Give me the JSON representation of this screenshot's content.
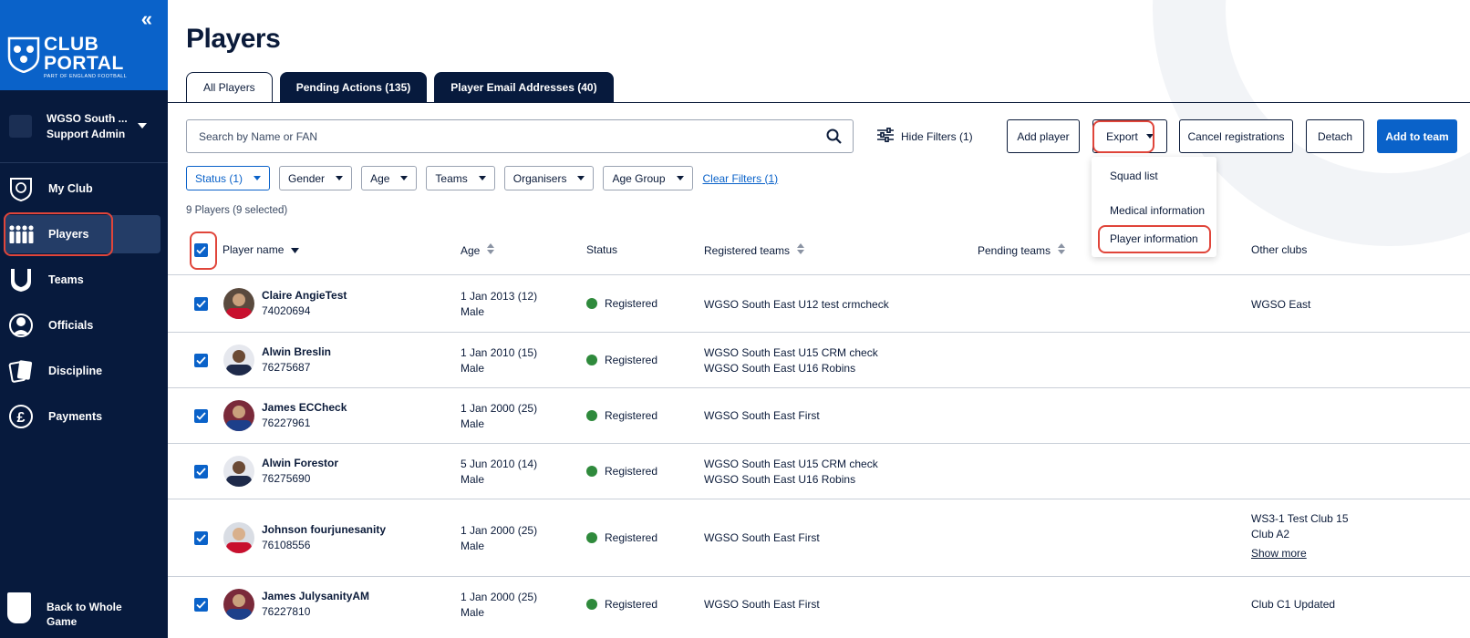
{
  "sidebar": {
    "logo": {
      "line1": "CLUB",
      "line2": "PORTAL",
      "line3": "PART OF ENGLAND FOOTBALL"
    },
    "account": {
      "name": "WGSO South ...",
      "role": "Support Admin"
    },
    "nav": [
      {
        "label": "My Club",
        "icon": "shield-icon"
      },
      {
        "label": "Players",
        "icon": "players-icon"
      },
      {
        "label": "Teams",
        "icon": "kit-icon"
      },
      {
        "label": "Officials",
        "icon": "whistle-icon"
      },
      {
        "label": "Discipline",
        "icon": "cards-icon"
      },
      {
        "label": "Payments",
        "icon": "pound-icon"
      }
    ],
    "back": "Back to Whole Game"
  },
  "page": {
    "title": "Players"
  },
  "tabs": [
    {
      "label": "All Players",
      "active": true
    },
    {
      "label": "Pending Actions (135)",
      "active": false
    },
    {
      "label": "Player Email Addresses (40)",
      "active": false
    }
  ],
  "search": {
    "placeholder": "Search by Name or FAN"
  },
  "toolbar": {
    "hide_filters": "Hide Filters (1)",
    "add_player": "Add player",
    "export": "Export",
    "cancel_registrations": "Cancel registrations",
    "detach": "Detach",
    "add_to_team": "Add to team"
  },
  "export_menu": [
    "Squad list",
    "Medical information",
    "Player information"
  ],
  "filters": {
    "chips": [
      "Status (1)",
      "Gender",
      "Age",
      "Teams",
      "Organisers",
      "Age Group"
    ],
    "clear": "Clear Filters (1)"
  },
  "summary": "9 Players (9 selected)",
  "columns": {
    "name": "Player name",
    "age": "Age",
    "status": "Status",
    "registered": "Registered teams",
    "pending": "Pending teams",
    "other": "Other clubs"
  },
  "rows": [
    {
      "name": "Claire AngieTest",
      "fan": "74020694",
      "dob": "1 Jan 2013 (12)",
      "gender": "Male",
      "status": "Registered",
      "teams": [
        "WGSO South East U12 test crmcheck"
      ],
      "other": [
        "WGSO East"
      ],
      "show_more": ""
    },
    {
      "name": "Alwin Breslin",
      "fan": "76275687",
      "dob": "1 Jan 2010 (15)",
      "gender": "Male",
      "status": "Registered",
      "teams": [
        "WGSO South East U15 CRM check",
        "WGSO South East U16 Robins"
      ],
      "other": [],
      "show_more": ""
    },
    {
      "name": "James ECCheck",
      "fan": "76227961",
      "dob": "1 Jan 2000 (25)",
      "gender": "Male",
      "status": "Registered",
      "teams": [
        "WGSO South East First"
      ],
      "other": [],
      "show_more": ""
    },
    {
      "name": "Alwin Forestor",
      "fan": "76275690",
      "dob": "5 Jun 2010 (14)",
      "gender": "Male",
      "status": "Registered",
      "teams": [
        "WGSO South East U15 CRM check",
        "WGSO South East U16 Robins"
      ],
      "other": [],
      "show_more": ""
    },
    {
      "name": "Johnson fourjunesanity",
      "fan": "76108556",
      "dob": "1 Jan 2000 (25)",
      "gender": "Male",
      "status": "Registered",
      "teams": [
        "WGSO South East First"
      ],
      "other": [
        "WS3-1 Test Club 15",
        "Club A2"
      ],
      "show_more": "Show more"
    },
    {
      "name": "James JulysanityAM",
      "fan": "76227810",
      "dob": "1 Jan 2000 (25)",
      "gender": "Male",
      "status": "Registered",
      "teams": [
        "WGSO South East First"
      ],
      "other": [
        "Club C1 Updated"
      ],
      "show_more": ""
    }
  ],
  "colors": {
    "navy": "#071a3d",
    "brand_blue": "#0a62c9",
    "highlight": "#e0453a",
    "registered": "#2f8a3c"
  }
}
